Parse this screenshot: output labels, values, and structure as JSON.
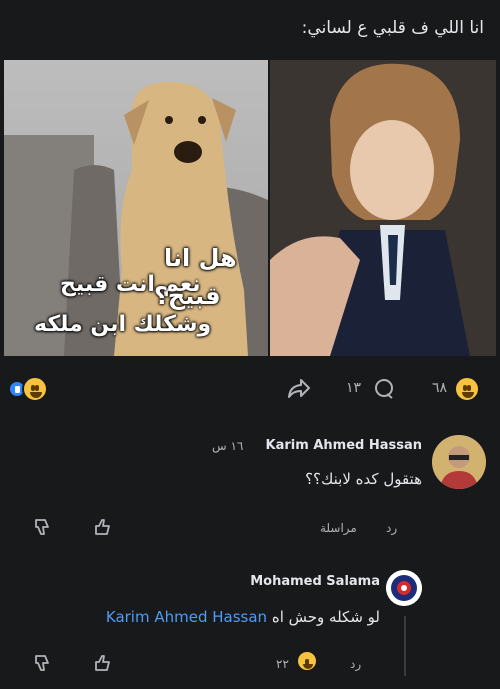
{
  "post": {
    "caption": "انا اللي ف قلبي ع لساني:",
    "meme_left_line1": "نعم انت قبيح",
    "meme_left_line2": "وشكلك ابن ملكه",
    "meme_right_line1": "هل انا",
    "meme_right_line2": "قبيح؟"
  },
  "reactions": {
    "count": "٦٨",
    "comments_count": "١٣"
  },
  "comments": [
    {
      "author": "Karim Ahmed Hassan",
      "time": "١٦ س",
      "text": "هتقول كده لابنك؟؟",
      "reply_label": "رد",
      "message_label": "مراسلة"
    },
    {
      "author": "Mohamed Salama",
      "mention": "Karim Ahmed Hassan",
      "text": "لو شكله وحش اه",
      "reply_label": "رد",
      "reaction_count": "٢٢"
    }
  ],
  "colors": {
    "background": "#18191a",
    "text": "#e4e6eb",
    "muted": "#b0b3b8",
    "link": "#4e9cf5",
    "like": "#2d88ff",
    "haha": "#f7c33f"
  }
}
